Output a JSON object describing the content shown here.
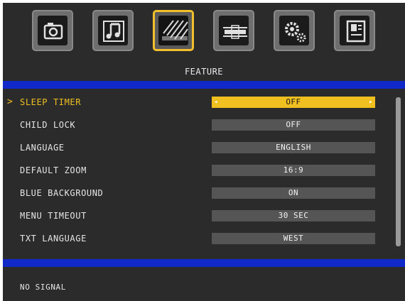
{
  "header": {
    "title": "FEATURE",
    "tabs": [
      {
        "icon": "picture-icon",
        "active": false
      },
      {
        "icon": "music-note-icon",
        "active": false
      },
      {
        "icon": "feature-stripes-icon",
        "active": true
      },
      {
        "icon": "connector-icon",
        "active": false
      },
      {
        "icon": "gears-icon",
        "active": false
      },
      {
        "icon": "document-icon",
        "active": false
      }
    ]
  },
  "menu": {
    "cursor": ">",
    "items": [
      {
        "label": "SLEEP TIMER",
        "value": "OFF",
        "selected": true
      },
      {
        "label": "CHILD LOCK",
        "value": "OFF"
      },
      {
        "label": "LANGUAGE",
        "value": "ENGLISH"
      },
      {
        "label": "DEFAULT ZOOM",
        "value": "16:9"
      },
      {
        "label": "BLUE BACKGROUND",
        "value": "ON"
      },
      {
        "label": "MENU TIMEOUT",
        "value": "30 SEC"
      },
      {
        "label": "TXT LANGUAGE",
        "value": "WEST"
      }
    ]
  },
  "status": "NO SIGNAL",
  "colors": {
    "background": "#2b2b2b",
    "accent": "#f0c020",
    "blue_bar": "#1129c8",
    "value_box": "#555555"
  }
}
